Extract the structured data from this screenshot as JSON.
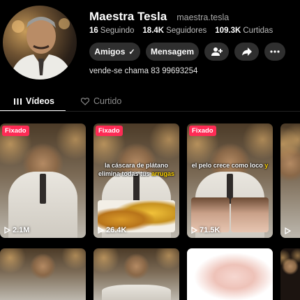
{
  "profile": {
    "display_name": "Maestra Tesla",
    "handle": "maestra.tesla",
    "bio": "vende-se chama 83 99693254"
  },
  "stats": {
    "following_count": "16",
    "following_label": "Seguindo",
    "followers_count": "18.4K",
    "followers_label": "Seguidores",
    "likes_count": "109.3K",
    "likes_label": "Curtidas"
  },
  "actions": {
    "friends_label": "Amigos",
    "friends_check": "✓",
    "message_label": "Mensagem",
    "add_friend_icon": "add-user-icon",
    "share_icon": "share-icon",
    "more_icon": "more-icon"
  },
  "tabs": {
    "videos_label": "Vídeos",
    "liked_label": "Curtido"
  },
  "videos": [
    {
      "pinned": "Fixado",
      "views": "2.1M",
      "caption": ""
    },
    {
      "pinned": "Fixado",
      "views": "26.4K",
      "caption_main": "la cáscara de plátano elimina todas tus",
      "caption_highlight": "arrugas"
    },
    {
      "pinned": "Fixado",
      "views": "71.5K",
      "caption_main": "el pelo crece como loco",
      "caption_highlight": "y"
    },
    {
      "pinned": "",
      "views": ""
    }
  ],
  "colors": {
    "background": "#000000",
    "pinned_badge": "#fe2c55",
    "button_bg": "#2f2f2f",
    "caption_highlight": "#ffd400"
  }
}
